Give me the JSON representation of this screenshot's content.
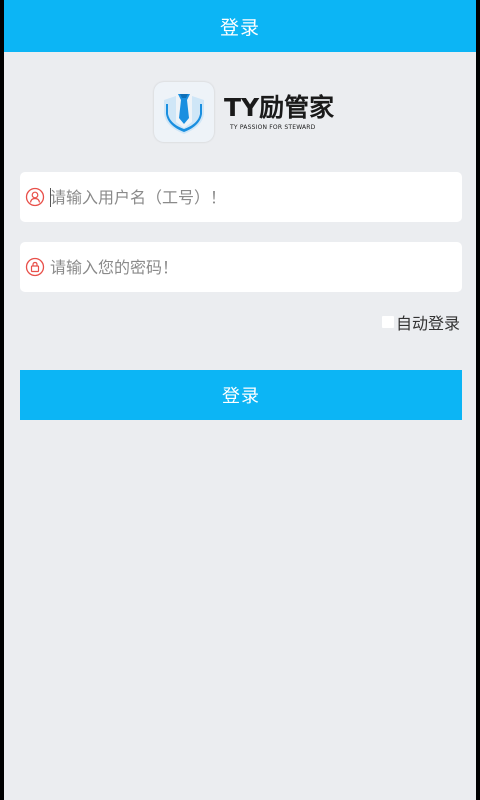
{
  "topbar": {
    "title": "登录"
  },
  "logo": {
    "name": "TY励管家",
    "subtitle": "TY PASSION FOR STEWARD"
  },
  "form": {
    "username": {
      "value": "",
      "placeholder": "请输入用户名（工号）！",
      "icon": "user-icon"
    },
    "password": {
      "value": "",
      "placeholder": "请输入您的密码！",
      "icon": "lock-icon"
    },
    "auto_login": {
      "label": "自动登录",
      "checked": false
    },
    "submit_label": "登录"
  },
  "colors": {
    "primary": "#0cb5f5",
    "background": "#ebedf0",
    "icon_red": "#e8504a",
    "logo_blue": "#1a8fe0"
  }
}
